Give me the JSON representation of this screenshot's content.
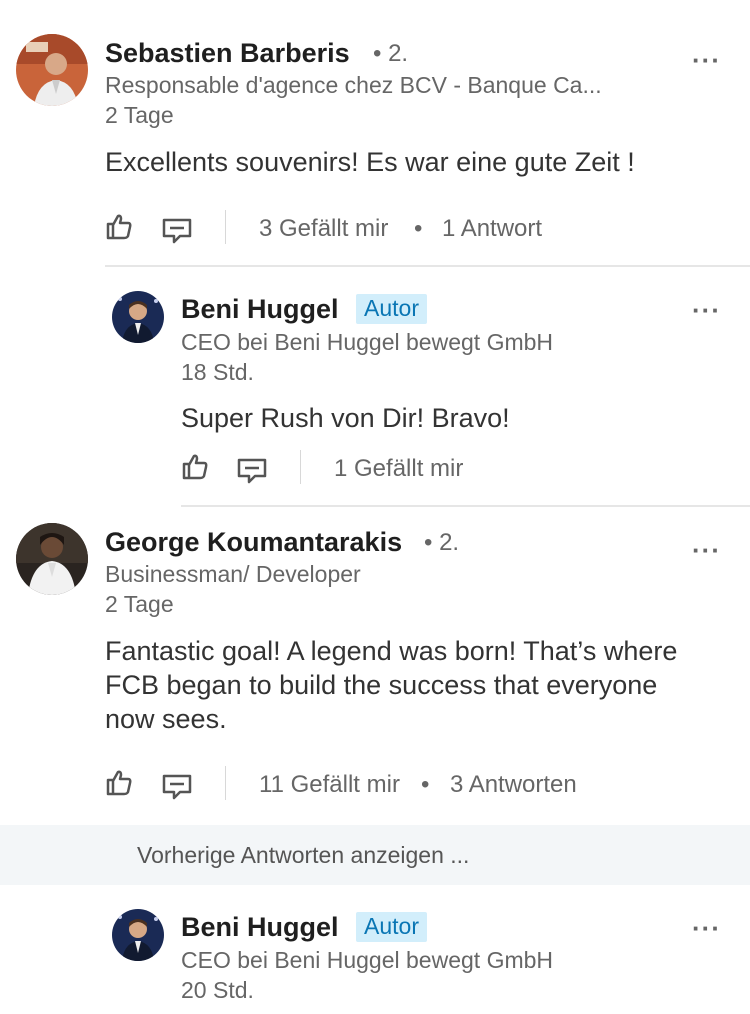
{
  "comments": [
    {
      "name": "Sebastien Barberis",
      "degree": "• 2.",
      "headline": "Responsable d'agence chez BCV - Banque Ca...",
      "time": "2 Tage",
      "text": "Excellents souvenirs! Es war eine gute Zeit !",
      "likes": "3 Gefällt mir",
      "replies": "1 Antwort",
      "replies_list": [
        {
          "name": "Beni Huggel",
          "badge": "Autor",
          "headline": "CEO bei Beni Huggel bewegt GmbH",
          "time": "18 Std.",
          "text": "Super Rush von Dir! Bravo!",
          "likes": "1 Gefällt mir"
        }
      ]
    },
    {
      "name": "George Koumantarakis",
      "degree": "• 2.",
      "headline": "Businessman/ Developer",
      "time": "2 Tage",
      "text": "Fantastic goal! A legend was born! That’s where FCB began to build the success that everyone now sees.",
      "likes": "11 Gefällt mir",
      "replies": "3 Antworten",
      "previous_replies_label": "Vorherige Antworten anzeigen ...",
      "replies_list": [
        {
          "name": "Beni Huggel",
          "badge": "Autor",
          "headline": "CEO bei Beni Huggel bewegt GmbH",
          "time": "20 Std."
        }
      ]
    }
  ],
  "more_label": "···",
  "dot_separator": "•",
  "icons": [
    "like-icon",
    "comment-icon",
    "more-icon"
  ],
  "colors": {
    "badge_bg": "#d2eefb",
    "badge_text": "#0a76b4",
    "muted": "#666666",
    "banner_bg": "#f3f6f8"
  }
}
